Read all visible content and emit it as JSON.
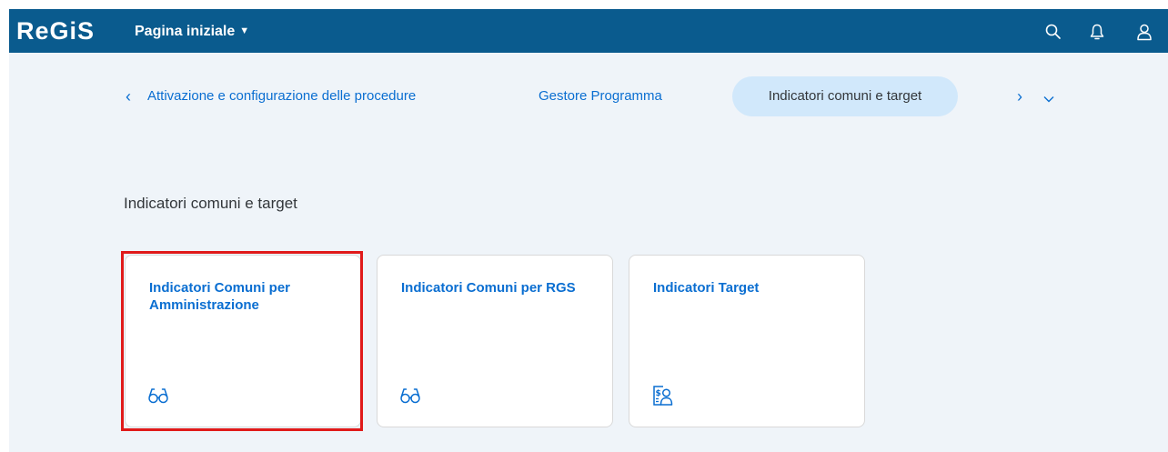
{
  "shell": {
    "logo": "ReGiS",
    "home_menu": "Pagina iniziale",
    "icons": [
      "search-icon",
      "bell-icon",
      "user-icon"
    ],
    "color": "#0a5b8e"
  },
  "anchor_bar": {
    "items": [
      "Attivazione e configurazione delle procedure",
      "Gestore Programma",
      "Indicatori comuni e target"
    ],
    "active_index": 2,
    "prev_icon": "chevron-left-icon",
    "next_icon": "chevron-right-icon",
    "overflow_icon": "chevron-down-icon"
  },
  "section": {
    "title": "Indicatori comuni e target"
  },
  "tiles": [
    {
      "title": "Indicatori Comuni per Amministrazione",
      "icon": "glasses-icon",
      "highlighted": true
    },
    {
      "title": "Indicatori Comuni per RGS",
      "icon": "glasses-icon",
      "highlighted": false
    },
    {
      "title": "Indicatori Target",
      "icon": "report-person-icon",
      "highlighted": false
    }
  ],
  "colors": {
    "accent": "#0a6ed1",
    "highlight": "#e01a1a",
    "background": "#eff4f9"
  }
}
